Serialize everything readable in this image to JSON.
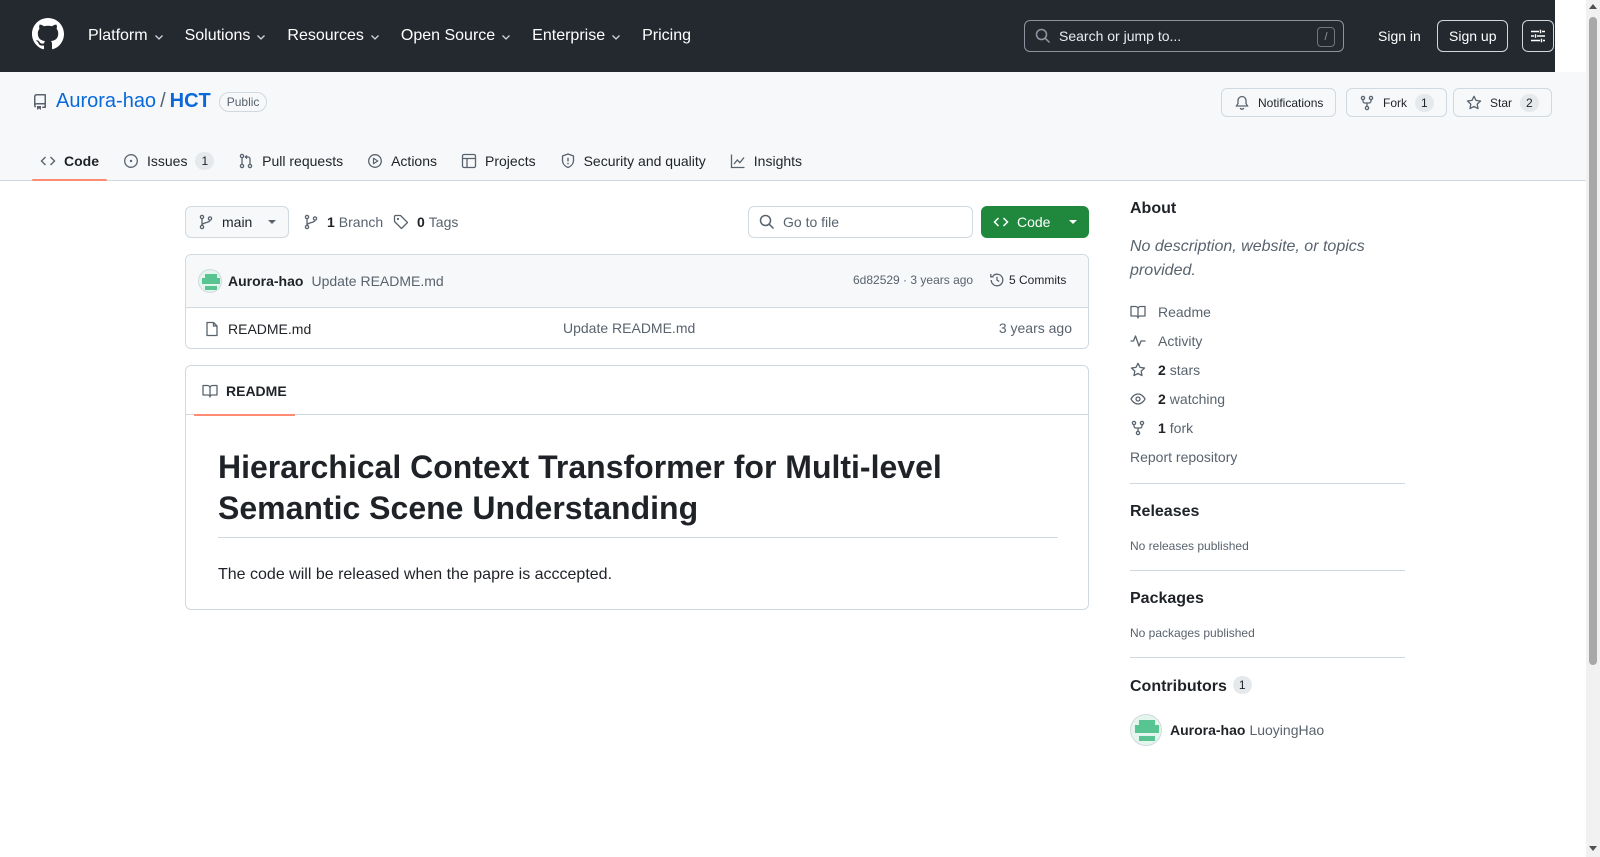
{
  "header": {
    "nav": [
      "Platform",
      "Solutions",
      "Resources",
      "Open Source",
      "Enterprise",
      "Pricing"
    ],
    "search_placeholder": "Search or jump to...",
    "search_shortcut": "/",
    "sign_in": "Sign in",
    "sign_up": "Sign up"
  },
  "repo": {
    "owner": "Aurora-hao",
    "separator": "/",
    "name": "HCT",
    "visibility": "Public",
    "notifications_label": "Notifications",
    "fork_label": "Fork",
    "fork_count": "1",
    "star_label": "Star",
    "star_count": "2"
  },
  "tabs": [
    {
      "label": "Code",
      "icon": "code-icon",
      "active": true
    },
    {
      "label": "Issues",
      "icon": "issue-icon",
      "count": "1"
    },
    {
      "label": "Pull requests",
      "icon": "pull-request-icon"
    },
    {
      "label": "Actions",
      "icon": "play-icon"
    },
    {
      "label": "Projects",
      "icon": "table-icon"
    },
    {
      "label": "Security and quality",
      "icon": "shield-icon"
    },
    {
      "label": "Insights",
      "icon": "graph-icon"
    }
  ],
  "toolbar": {
    "branch": "main",
    "branch_count": "1",
    "branch_label": "Branch",
    "tag_count": "0",
    "tag_label": "Tags",
    "goto_placeholder": "Go to file",
    "code_label": "Code"
  },
  "commit": {
    "author": "Aurora-hao",
    "message": "Update README.md",
    "hash_age": "6d82529 · 3 years ago",
    "commits_label": "5 Commits"
  },
  "files": [
    {
      "name": "README.md",
      "message": "Update README.md",
      "age": "3 years ago"
    }
  ],
  "readme": {
    "tab_label": "README",
    "heading": "Hierarchical Context Transformer for Multi-level Semantic Scene Understanding",
    "body": "The code will be released when the papre is acccepted."
  },
  "sidebar": {
    "about_title": "About",
    "about_desc": "No description, website, or topics provided.",
    "readme": "Readme",
    "activity": "Activity",
    "stars_count": "2",
    "stars_label": "stars",
    "watching_count": "2",
    "watching_label": "watching",
    "fork_count": "1",
    "fork_label": "fork",
    "report": "Report repository",
    "releases_title": "Releases",
    "releases_text": "No releases published",
    "packages_title": "Packages",
    "packages_text": "No packages published",
    "contributors_title": "Contributors",
    "contributors_count": "1",
    "contributor_login": "Aurora-hao",
    "contributor_name": "LuoyingHao"
  },
  "colors": {
    "header_bg": "#24292f",
    "link": "#0969da",
    "primary_button": "#1f883d",
    "active_tab_underline": "#fd8c73"
  }
}
